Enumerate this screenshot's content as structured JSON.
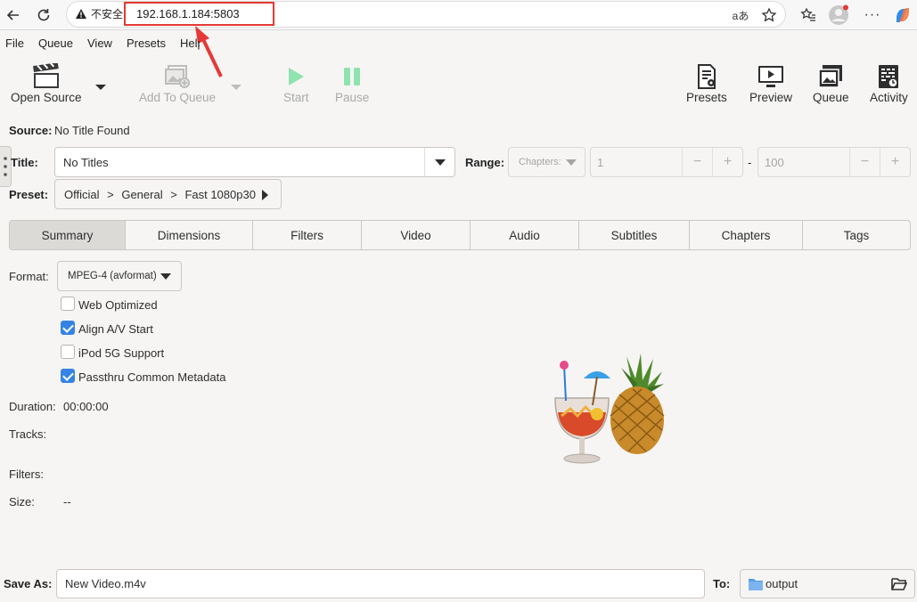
{
  "browser": {
    "warning": "不安全",
    "url": "192.168.1.184:5803",
    "translate_label": "aあ"
  },
  "menu": [
    "File",
    "Queue",
    "View",
    "Presets",
    "Help"
  ],
  "toolbar": {
    "open_source": "Open Source",
    "add_to_queue": "Add To Queue",
    "start": "Start",
    "pause": "Pause",
    "presets": "Presets",
    "preview": "Preview",
    "queue": "Queue",
    "activity": "Activity"
  },
  "source": {
    "label": "Source:",
    "value": "No Title Found"
  },
  "title": {
    "label": "Title:",
    "value": "No Titles"
  },
  "range": {
    "label": "Range:",
    "mode": "Chapters:",
    "start": "1",
    "end": "100",
    "separator": "-"
  },
  "preset": {
    "label": "Preset:",
    "path": [
      "Official",
      "General",
      "Fast 1080p30"
    ],
    "sep": ">"
  },
  "tabs": [
    "Summary",
    "Dimensions",
    "Filters",
    "Video",
    "Audio",
    "Subtitles",
    "Chapters",
    "Tags"
  ],
  "summary": {
    "format_label": "Format:",
    "format_value": "MPEG-4 (avformat)",
    "options": [
      {
        "label": "Web Optimized",
        "checked": false
      },
      {
        "label": "Align A/V Start",
        "checked": true
      },
      {
        "label": "iPod 5G Support",
        "checked": false
      },
      {
        "label": "Passthru Common Metadata",
        "checked": true
      }
    ],
    "duration_label": "Duration:",
    "duration_value": "00:00:00",
    "tracks_label": "Tracks:",
    "filters_label": "Filters:",
    "size_label": "Size:",
    "size_value": "--"
  },
  "save": {
    "label": "Save As:",
    "value": "New Video.m4v",
    "to_label": "To:",
    "folder": "output"
  },
  "colors": {
    "accent": "#3584e4",
    "highlight_red": "#e53935",
    "start_green": "#57e389"
  }
}
